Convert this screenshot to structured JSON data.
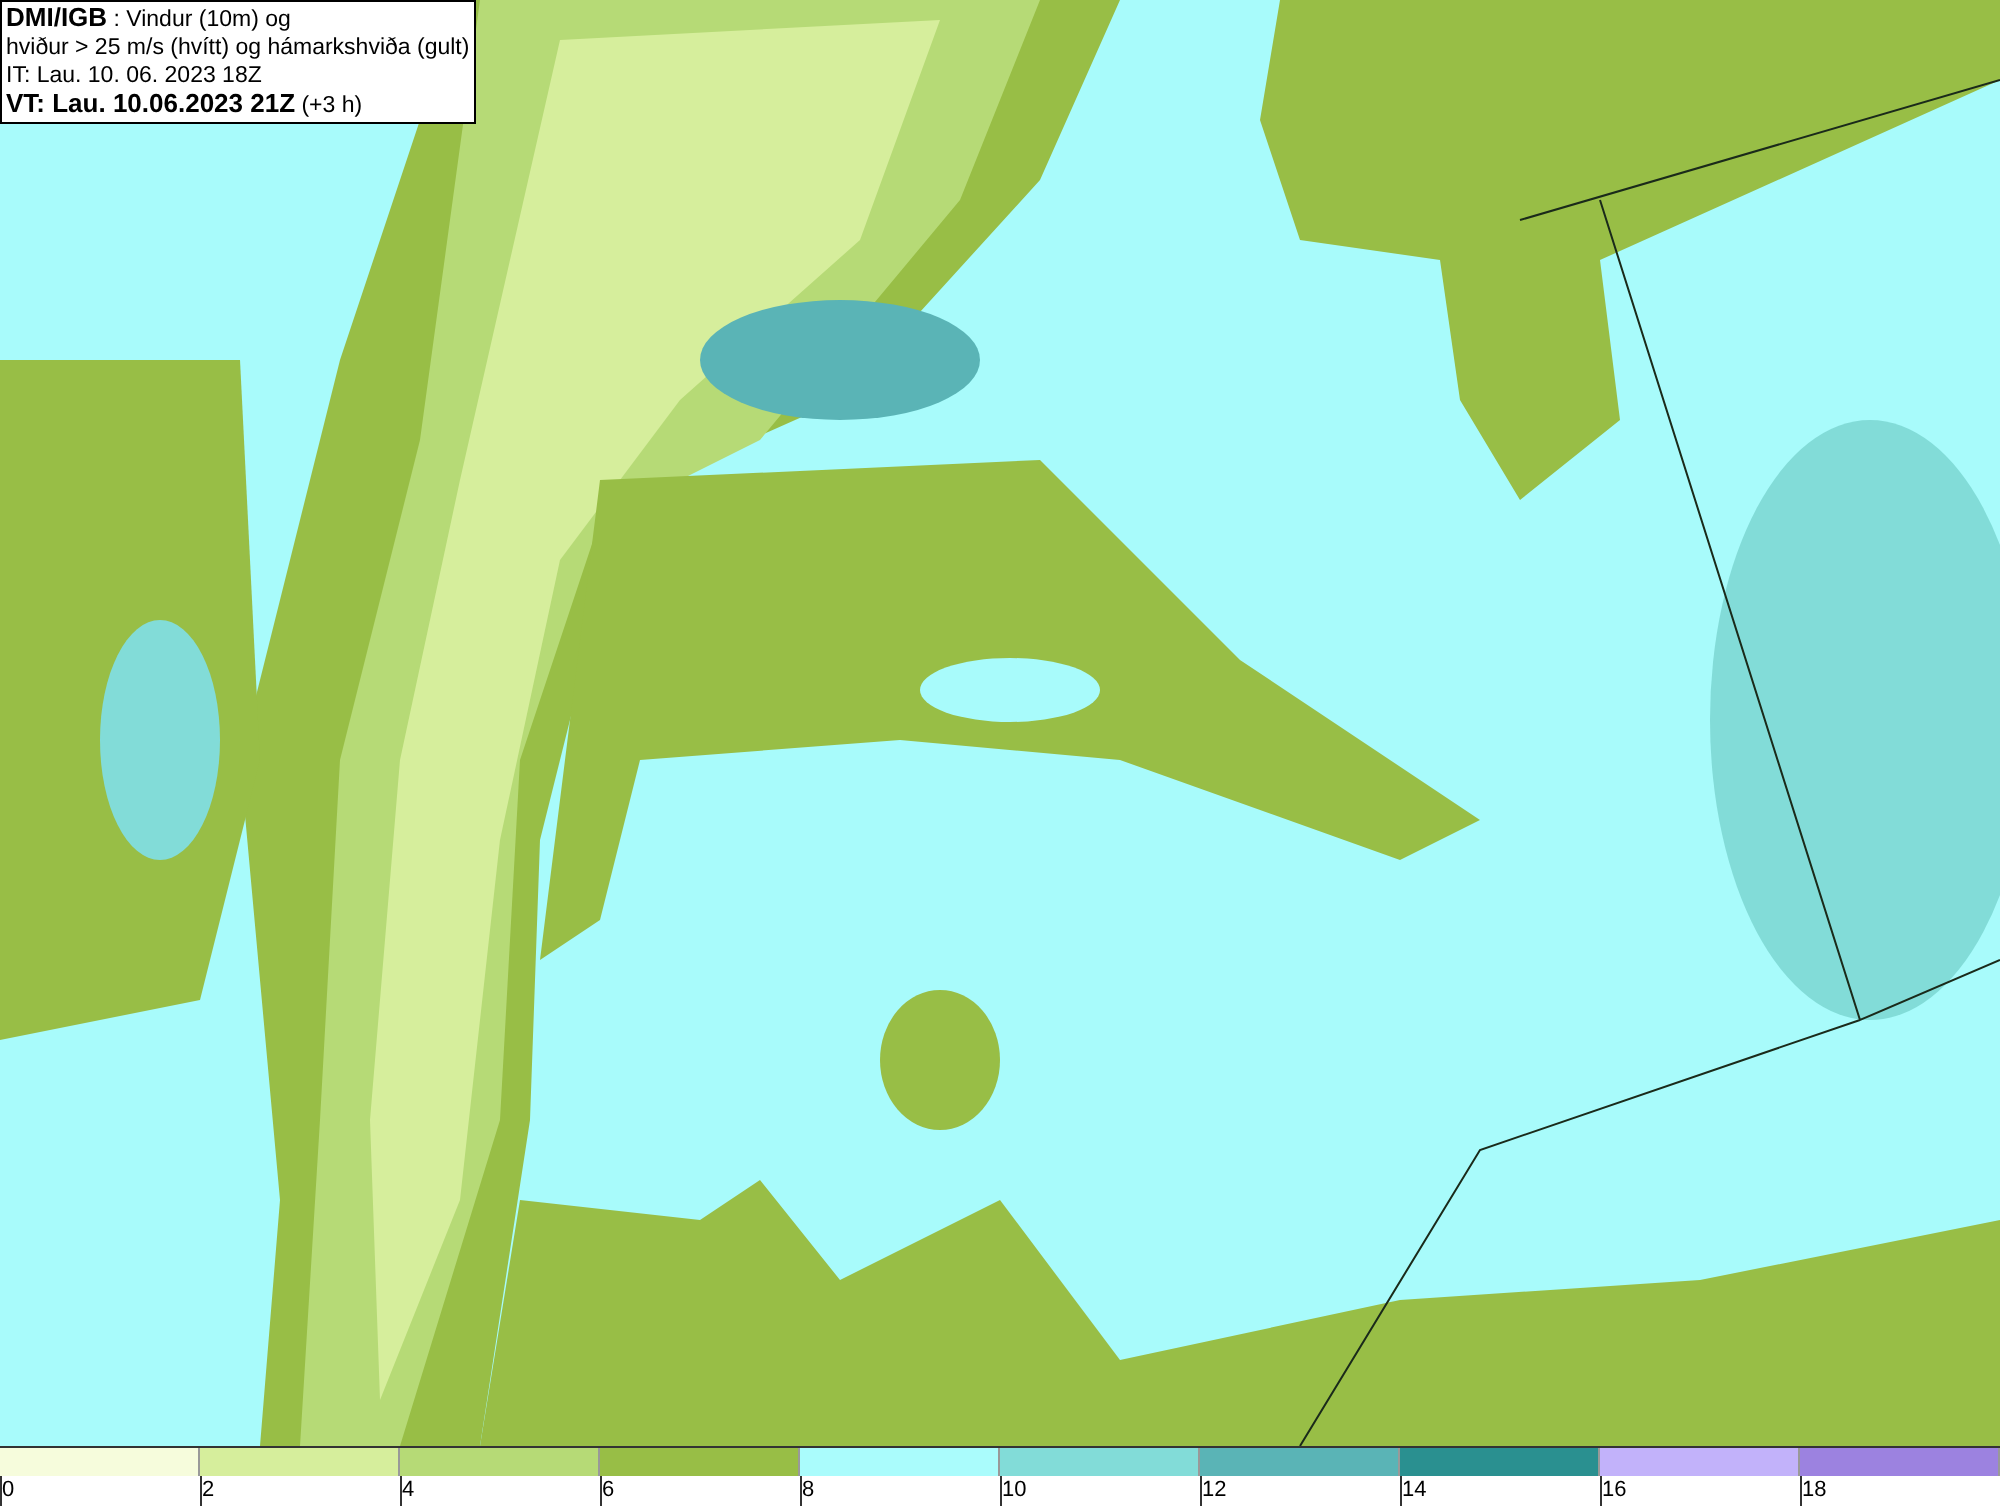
{
  "header": {
    "lines": [
      "**DMI/IGB** : Vindur (10m) og",
      "hviður > 25 m/s (hvítt) og hámarkshviða (gult)",
      "IT: Lau. 10. 06. 2023 18Z",
      "**VT: Lau. 10.06.2023 21Z** (+3 h)"
    ]
  },
  "legend": {
    "bins": [
      {
        "color": "#f6fcdc"
      },
      {
        "color": "#d6ee9c"
      },
      {
        "color": "#b6da76"
      },
      {
        "color": "#98be46"
      },
      {
        "color": "#aafcfc"
      },
      {
        "color": "#82dcd8"
      },
      {
        "color": "#5ab4b6"
      },
      {
        "color": "#2a9090"
      },
      {
        "color": "#c2b2fa"
      },
      {
        "color": "#9c82e0"
      }
    ],
    "ticks": [
      "0",
      "2",
      "4",
      "6",
      "8",
      "10",
      "12",
      "14",
      "16",
      "18"
    ]
  }
}
